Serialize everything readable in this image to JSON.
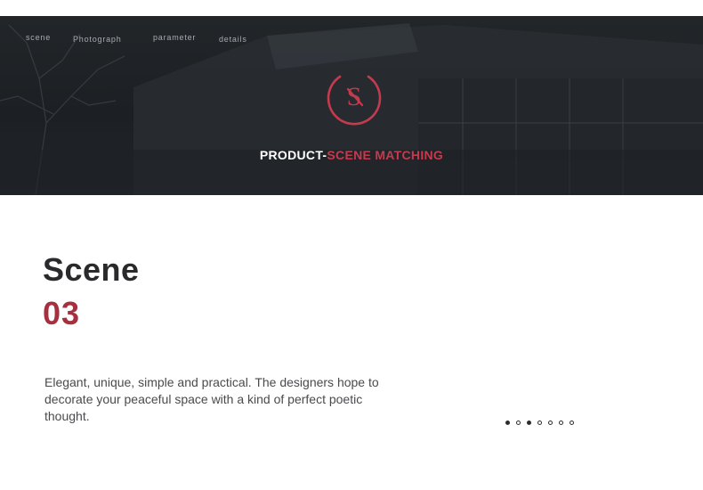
{
  "nav": {
    "items": [
      {
        "label": "scene"
      },
      {
        "label": "Photograph"
      },
      {
        "label": "parameter"
      },
      {
        "label": "details"
      }
    ]
  },
  "hero": {
    "title_part1": "PRODUCT-",
    "title_part2": "SCENE MATCHING",
    "logo_icon": "s-monogram-icon",
    "accent_color": "#c63a4e"
  },
  "scene": {
    "label": "Scene",
    "number": "03",
    "description": "Elegant, unique, simple and practical. The designers hope to decorate your peaceful space with a kind of perfect poetic thought.",
    "number_color": "#a5303f"
  },
  "carousel": {
    "dot_count": 7,
    "filled_dots": [
      1,
      3
    ]
  }
}
